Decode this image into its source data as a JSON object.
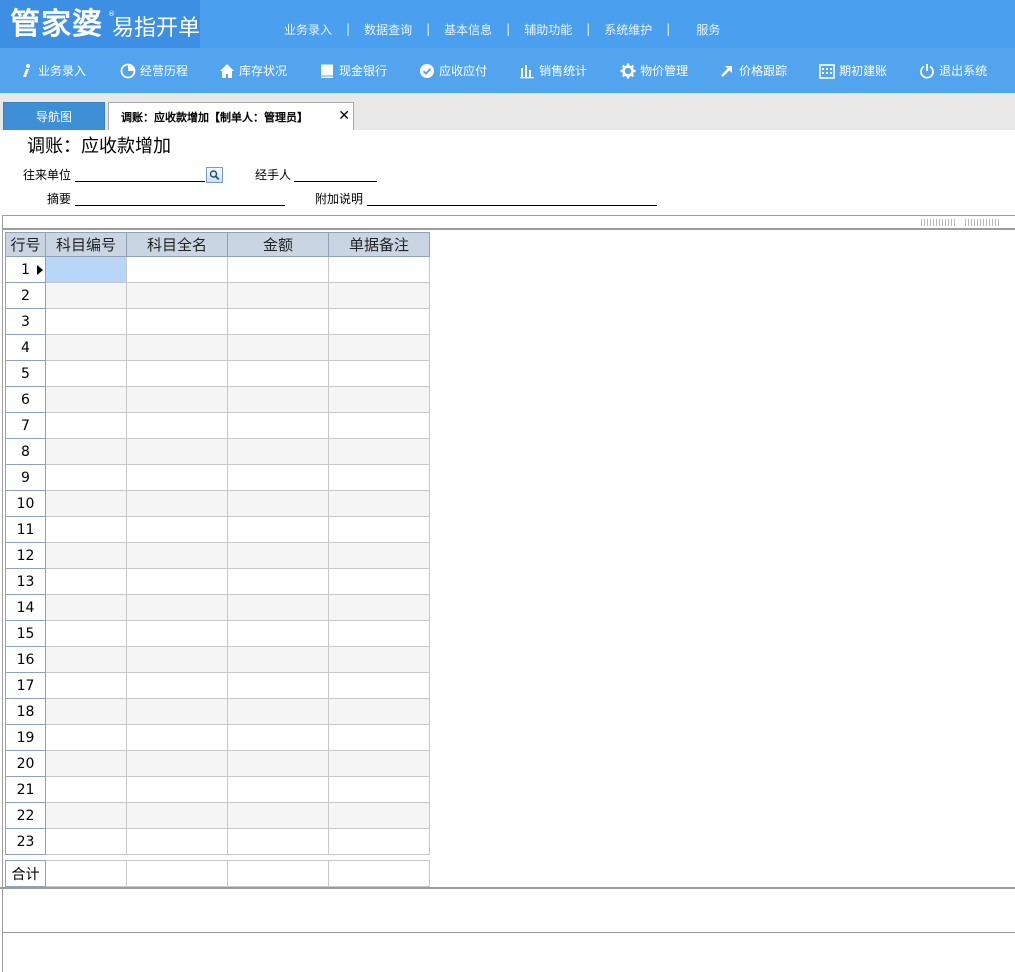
{
  "brand": {
    "main": "管家婆",
    "sub": "易指开单",
    "reg": "®"
  },
  "topnav": {
    "items": [
      "业务录入",
      "数据查询",
      "基本信息",
      "辅助功能",
      "系统维护",
      "服务"
    ],
    "sep": "|"
  },
  "toolbar": {
    "items": [
      {
        "label": "业务录入",
        "icon": "info-icon"
      },
      {
        "label": "经营历程",
        "icon": "pie-icon"
      },
      {
        "label": "库存状况",
        "icon": "home-icon"
      },
      {
        "label": "现金银行",
        "icon": "book-icon"
      },
      {
        "label": "应收应付",
        "icon": "check-circle-icon"
      },
      {
        "label": "销售统计",
        "icon": "bar-chart-icon"
      },
      {
        "label": "物价管理",
        "icon": "gear-icon"
      },
      {
        "label": "价格跟踪",
        "icon": "arrow-up-right-icon"
      },
      {
        "label": "期初建账",
        "icon": "calendar-icon"
      },
      {
        "label": "退出系统",
        "icon": "power-icon"
      }
    ]
  },
  "tabs": {
    "nav": "导航图",
    "doc": "调账：应收款增加【制单人：管理员】",
    "close": "✕"
  },
  "form": {
    "title": "调账：应收款增加",
    "partner_label": "往来单位",
    "handler_label": "经手人",
    "summary_label": "摘要",
    "note_label": "附加说明"
  },
  "grid": {
    "headers": [
      "行号",
      "科目编号",
      "科目全名",
      "金额",
      "单据备注"
    ],
    "rows": [
      "1",
      "2",
      "3",
      "4",
      "5",
      "6",
      "7",
      "8",
      "9",
      "10",
      "11",
      "12",
      "13",
      "14",
      "15",
      "16",
      "17",
      "18",
      "19",
      "20",
      "21",
      "22",
      "23"
    ],
    "selected_row": 1,
    "total_label": "合计"
  },
  "colors": {
    "header_blue": "#4a9fee",
    "toolbar_blue": "#53a4ef",
    "selection": "#b8d7f8"
  }
}
